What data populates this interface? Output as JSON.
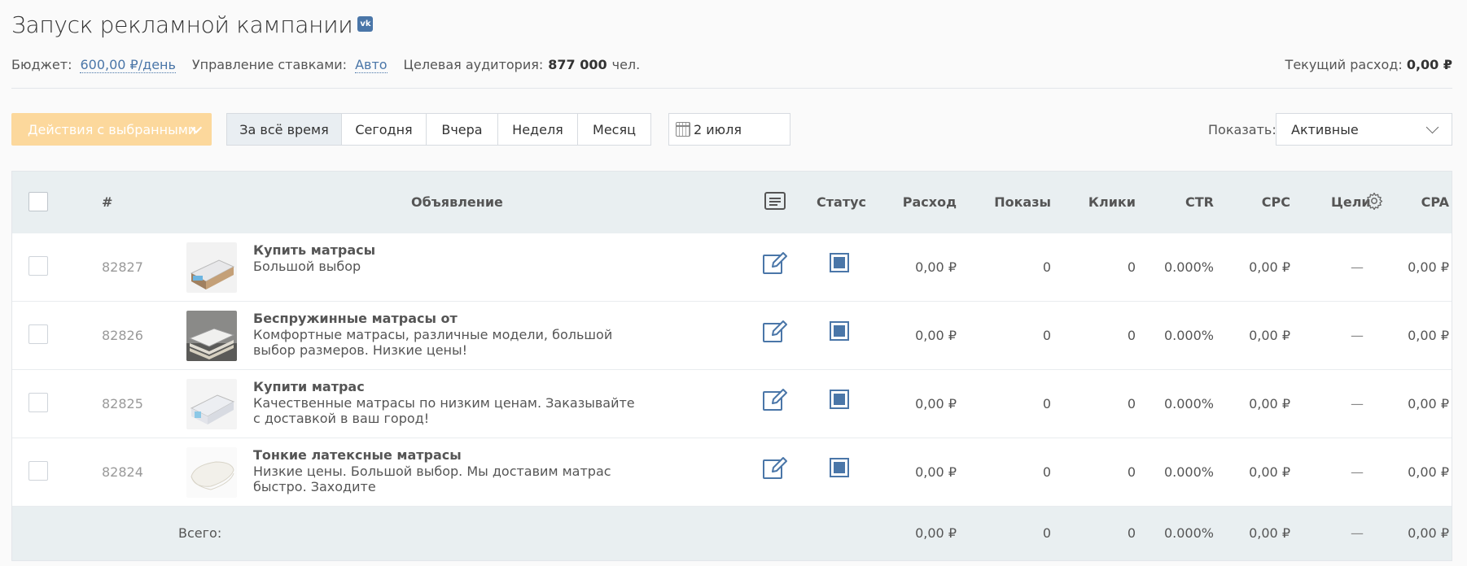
{
  "header": {
    "title": "Запуск рекламной кампании",
    "vk_badge": "vk"
  },
  "meta": {
    "budget_label": "Бюджет:",
    "budget_value": "600,00 ₽/день",
    "bids_label": "Управление ставками:",
    "bids_value": "Авто",
    "audience_label": "Целевая аудитория:",
    "audience_value": "877 000",
    "audience_unit": "чел.",
    "spend_label": "Текущий расход:",
    "spend_value": "0,00 ₽"
  },
  "toolbar": {
    "actions_label": "Действия с выбранными",
    "periods": [
      "За всё время",
      "Сегодня",
      "Вчера",
      "Неделя",
      "Месяц"
    ],
    "active_period": "За всё время",
    "date_value": "2 июля",
    "show_label": "Показать:",
    "show_value": "Активные"
  },
  "table": {
    "columns": {
      "id": "#",
      "ad": "Объявление",
      "status": "Статус",
      "spend": "Расход",
      "impressions": "Показы",
      "clicks": "Клики",
      "ctr": "CTR",
      "cpc": "CPC",
      "goals": "Цели",
      "cpa": "CPA"
    },
    "rows": [
      {
        "id": "82827",
        "title": "Купить матрасы",
        "text": "Большой выбор",
        "spend": "0,00 ₽",
        "impressions": "0",
        "clicks": "0",
        "ctr": "0.000%",
        "cpc": "0,00 ₽",
        "goals": "—",
        "cpa": "0,00 ₽"
      },
      {
        "id": "82826",
        "title": "Беспружинные матрасы от",
        "text": "Комфортные матрасы, различные модели, большой выбор размеров. Низкие цены!",
        "spend": "0,00 ₽",
        "impressions": "0",
        "clicks": "0",
        "ctr": "0.000%",
        "cpc": "0,00 ₽",
        "goals": "—",
        "cpa": "0,00 ₽"
      },
      {
        "id": "82825",
        "title": "Купити матрас",
        "text": "Качественные матрасы по низким ценам. Заказывайте с доставкой в ваш город!",
        "spend": "0,00 ₽",
        "impressions": "0",
        "clicks": "0",
        "ctr": "0.000%",
        "cpc": "0,00 ₽",
        "goals": "—",
        "cpa": "0,00 ₽"
      },
      {
        "id": "82824",
        "title": "Тонкие латексные матрасы",
        "text": "Низкие цены. Большой выбор. Мы доставим матрас быстро. Заходите",
        "spend": "0,00 ₽",
        "impressions": "0",
        "clicks": "0",
        "ctr": "0.000%",
        "cpc": "0,00 ₽",
        "goals": "—",
        "cpa": "0,00 ₽"
      }
    ],
    "total": {
      "label": "Всего:",
      "spend": "0,00 ₽",
      "impressions": "0",
      "clicks": "0",
      "ctr": "0.000%",
      "cpc": "0,00 ₽",
      "goals": "—",
      "cpa": "0,00 ₽"
    }
  },
  "icons": {
    "vk": "vk-logo-icon",
    "calendar": "calendar-icon",
    "preview": "ad-preview-icon",
    "goals_settings": "gear-icon",
    "edit": "edit-icon",
    "status": "status-active-icon"
  },
  "colors": {
    "accent": "#4a76a8",
    "actions_button": "#fcd89c",
    "table_header_bg": "#e9eff1"
  }
}
